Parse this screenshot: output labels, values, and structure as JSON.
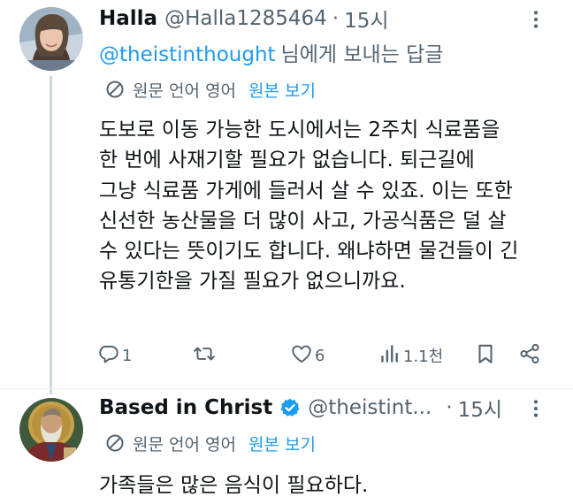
{
  "posts": [
    {
      "display_name": "Halla",
      "handle": "@Halla1285464",
      "separator": "·",
      "time": "15시",
      "reply_to": {
        "mention": "@theistinthought",
        "suffix": "님에게 보내는 답글"
      },
      "translation": {
        "label": "원문 언어 영어",
        "show_original": "원본 보기"
      },
      "text_lines": [
        "도보로 이동 가능한 도시에서는 2주치 식료품을",
        "한 번에 사재기할 필요가 없습니다. 퇴근길에",
        "그냥 식료품 가게에 들러서 살 수 있죠. 이는 또한",
        "신선한 농산물을 더 많이 사고, 가공식품은 덜 살",
        "수 있다는 뜻이기도 합니다. 왜냐하면 물건들이 긴",
        "유통기한을 가질 필요가 없으니까요."
      ],
      "actions": {
        "reply_count": "1",
        "retweet_count": "",
        "like_count": "6",
        "view_count": "1.1천"
      },
      "icons": [
        "more-icon",
        "translate-icon",
        "reply-icon",
        "retweet-icon",
        "like-icon",
        "views-icon",
        "bookmark-icon",
        "share-icon"
      ]
    },
    {
      "display_name": "Based in Christ",
      "handle": "@theistint...",
      "separator": "·",
      "time": "15시",
      "verified": true,
      "translation": {
        "label": "원문 언어 영어",
        "show_original": "원본 보기"
      },
      "text_lines": [
        "가족들은 많은 음식이 필요하다."
      ],
      "icons": [
        "verified-badge-icon",
        "more-icon",
        "translate-icon"
      ]
    }
  ],
  "colors": {
    "text": "#0f1419",
    "secondary": "#536471",
    "accent": "#1d9bf0",
    "thread_line": "#cfd9de"
  }
}
